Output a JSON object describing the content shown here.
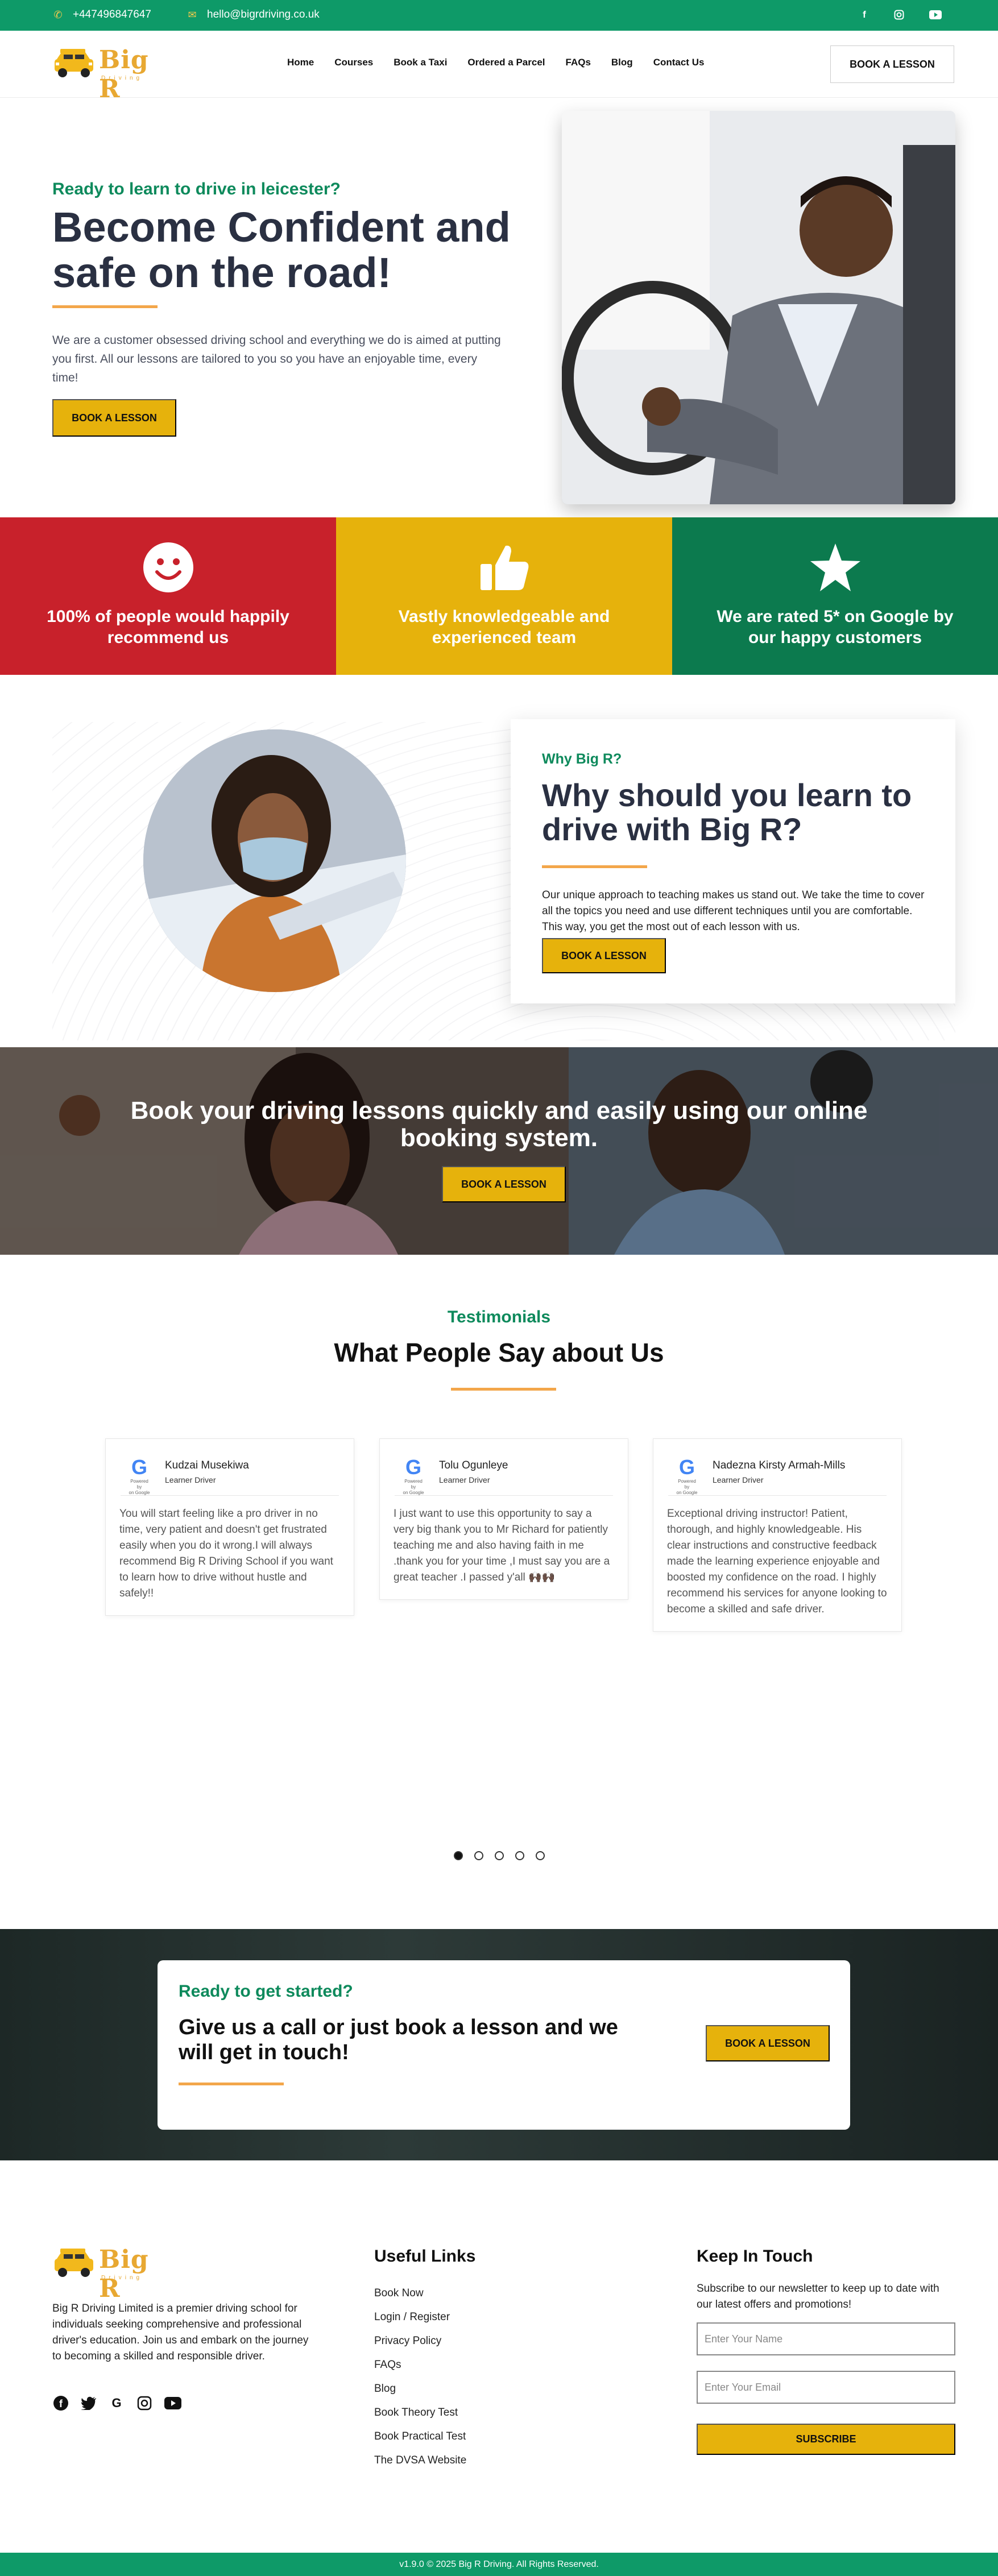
{
  "topbar": {
    "phone": "+447496847647",
    "email": "hello@bigrdriving.co.uk",
    "social_icons": [
      "facebook-icon",
      "instagram-icon",
      "youtube-icon"
    ]
  },
  "header": {
    "logo_text": "Big R",
    "logo_tagline": "Driving",
    "nav": [
      "Home",
      "Courses",
      "Book a Taxi",
      "Ordered a Parcel",
      "FAQs",
      "Blog",
      "Contact Us"
    ],
    "cta": "BOOK A LESSON"
  },
  "hero": {
    "eyebrow": "Ready to learn to drive in leicester?",
    "title": "Become Confident and safe on the road!",
    "text": "We are a customer obsessed driving school and everything we do is aimed at putting you first. All our lessons are tailored to you so you have an enjoyable time, every time!",
    "button": "BOOK A LESSON"
  },
  "features": [
    {
      "text": "100% of people would happily recommend us",
      "icon": "smiley-icon",
      "color": "#c8212b"
    },
    {
      "text": "Vastly knowledgeable and experienced team",
      "icon": "thumbs-up-icon",
      "color": "#e6b20c"
    },
    {
      "text": "We are rated 5* on Google by our happy customers",
      "icon": "star-icon",
      "color": "#0c7a4e"
    }
  ],
  "why": {
    "eyebrow": "Why Big R?",
    "title": "Why should you learn to drive with Big R?",
    "text": "Our unique approach to teaching makes us stand out. We take the time to cover all the topics you need and use different techniques until you are comfortable. This way, you get the most out of each lesson with us.",
    "button": "BOOK A LESSON"
  },
  "banner": {
    "title": "Book your driving lessons quickly and easily using our online booking system.",
    "button": "BOOK A LESSON"
  },
  "testimonials": {
    "eyebrow": "Testimonials",
    "title": "What People Say about Us",
    "powered_by": "Powered by",
    "powered_source": "on Google",
    "items": [
      {
        "name": "Kudzai Musekiwa",
        "role": "Learner Driver",
        "text": "You will start feeling like a pro driver in no time, very patient and doesn't get frustrated easily when you do it wrong.I will always recommend Big R Driving School if you want to learn how to drive without hustle and safely!!"
      },
      {
        "name": "Tolu Ogunleye",
        "role": "Learner Driver",
        "text": "I just want to use this opportunity to say a very big thank you to Mr Richard for patiently teaching me and also having faith in me .thank you for your time ,I must say you are a great teacher .I passed y'all 🙌🏿🙌🏿"
      },
      {
        "name": "Nadezna Kirsty Armah-Mills",
        "role": "Learner Driver",
        "text": "Exceptional driving instructor! Patient, thorough, and highly knowledgeable. His clear instructions and constructive feedback made the learning experience enjoyable and boosted my confidence on the road. I highly recommend his services for anyone looking to become a skilled and safe driver."
      }
    ],
    "active_dot": 1,
    "dot_count": 5
  },
  "cta": {
    "eyebrow": "Ready to get started?",
    "title": "Give us a call or just book a lesson and we will get in touch!",
    "button": "BOOK A LESSON"
  },
  "footer": {
    "about": "Big R Driving Limited is a premier driving school for individuals seeking comprehensive and professional driver's education. Join us and embark on the journey to becoming a skilled and responsible driver.",
    "social_icons": [
      "facebook-icon",
      "twitter-icon",
      "google-icon",
      "instagram-icon",
      "youtube-icon"
    ],
    "links_title": "Useful Links",
    "links": [
      "Book Now",
      "Login / Register",
      "Privacy Policy",
      "FAQs",
      "Blog",
      "Book Theory Test",
      "Book Practical Test",
      "The DVSA Website"
    ],
    "keep_title": "Keep In Touch",
    "keep_text": "Subscribe to our newsletter to keep up to date with our latest offers and promotions!",
    "name_placeholder": "Enter Your Name",
    "email_placeholder": "Enter Your Email",
    "subscribe": "SUBSCRIBE",
    "copyright": "v1.9.0 © 2025 Big R Driving. All Rights Reserved."
  }
}
